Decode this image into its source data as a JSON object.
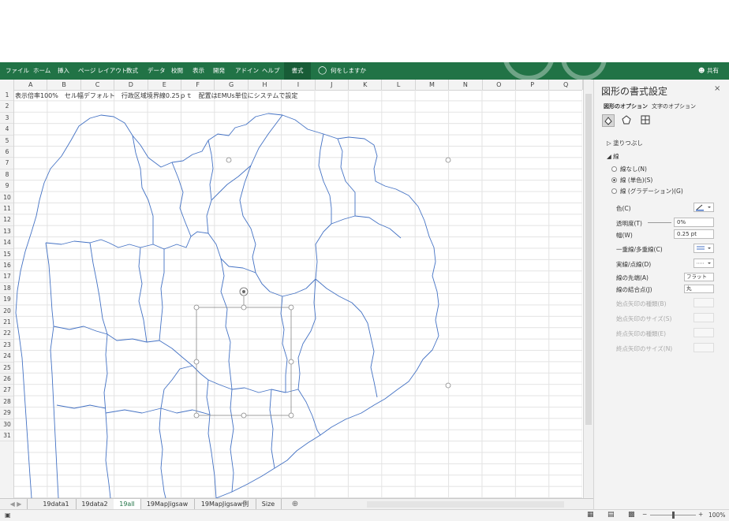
{
  "ribbon": {
    "tabs": [
      "ファイル",
      "ホーム",
      "挿入",
      "ページ レイアウト",
      "数式",
      "データ",
      "校閲",
      "表示",
      "開発",
      "アドイン",
      "ヘルプ"
    ],
    "active_tab": "書式",
    "tellme": "何をしますか",
    "share": "共有",
    "color": "#217346"
  },
  "columns": [
    "A",
    "B",
    "C",
    "D",
    "E",
    "F",
    "G",
    "H",
    "I",
    "J",
    "K",
    "L",
    "M",
    "N",
    "O",
    "P",
    "Q"
  ],
  "rows": [
    "1",
    "2",
    "3",
    "4",
    "5",
    "6",
    "7",
    "8",
    "9",
    "10",
    "11",
    "12",
    "13",
    "14",
    "15",
    "16",
    "17",
    "18",
    "19",
    "20",
    "21",
    "22",
    "23",
    "24",
    "25",
    "26",
    "27",
    "28",
    "29",
    "30",
    "31"
  ],
  "cell_a1": "表示倍率100%　セル幅デフォルト　行政区域境界線0.25ｐｔ　配置はEMUs単位にシステムで設定",
  "sheets": {
    "tabs": [
      "19data1",
      "19data2",
      "19all",
      "19MapJigsaw",
      "19MapJigsaw例",
      "Size"
    ],
    "active": "19all",
    "add": "⊕"
  },
  "status": {
    "zoom": "100%"
  },
  "pane": {
    "title": "図形の書式設定",
    "close": "×",
    "tab_shape": "図形のオプション",
    "tab_text": "文字のオプション",
    "icons": [
      "fill-line-icon",
      "effects-icon",
      "size-properties-icon"
    ],
    "section_fill": "塗りつぶし",
    "section_line": "線",
    "radios": [
      {
        "label": "線なし(N)",
        "checked": false
      },
      {
        "label": "線 (単色)(S)",
        "checked": true
      },
      {
        "label": "線 (グラデーション)(G)",
        "checked": false
      }
    ],
    "props": {
      "color": "色(C)",
      "transparency": "透明度(T)",
      "transparency_value": "0%",
      "width": "幅(W)",
      "width_value": "0.25 pt",
      "compound": "一重線/多重線(C)",
      "dash": "実線/点線(D)",
      "cap": "線の先端(A)",
      "cap_value": "フラット",
      "join": "線の結合点(J)",
      "join_value": "丸",
      "begin_type": "始点矢印の種類(B)",
      "begin_size": "始点矢印のサイズ(S)",
      "end_type": "終点矢印の種類(E)",
      "end_size": "終点矢印のサイズ(N)"
    },
    "line_color": "#4472c4"
  }
}
